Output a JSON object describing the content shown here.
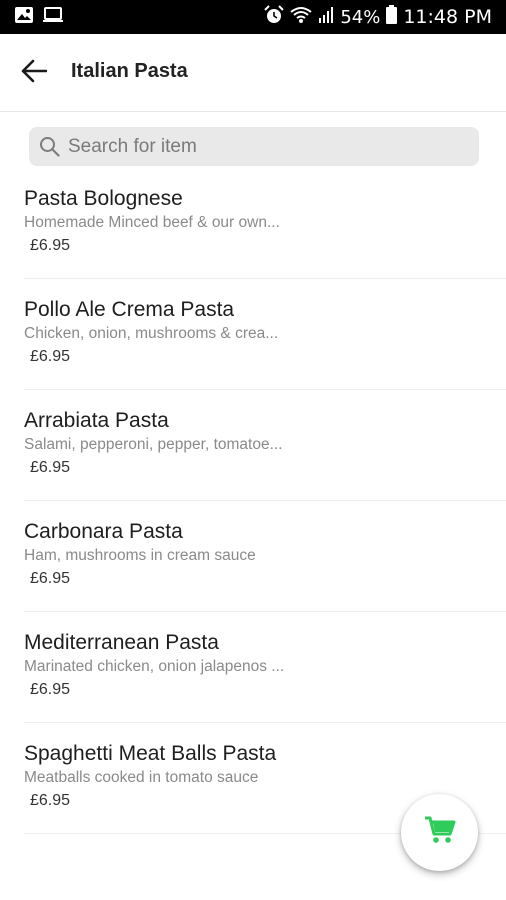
{
  "status_bar": {
    "battery_percent": "54%",
    "time": "11:48 PM",
    "icons": [
      "image-icon",
      "laptop-icon",
      "alarm-icon",
      "wifi-icon",
      "signal-icon",
      "battery-icon"
    ]
  },
  "header": {
    "title": "Italian Pasta",
    "back_icon": "arrow-left-icon"
  },
  "search": {
    "placeholder": "Search for item",
    "value": ""
  },
  "items": [
    {
      "name": "Pasta Bolognese",
      "description": "Homemade  Minced beef & our own...",
      "price": "£6.95"
    },
    {
      "name": "Pollo Ale Crema Pasta",
      "description": "Chicken, onion, mushrooms & crea...",
      "price": "£6.95"
    },
    {
      "name": "Arrabiata Pasta",
      "description": "Salami, pepperoni, pepper, tomatoe...",
      "price": "£6.95"
    },
    {
      "name": "Carbonara Pasta",
      "description": "Ham, mushrooms in cream sauce",
      "price": "£6.95"
    },
    {
      "name": "Mediterranean Pasta",
      "description": "Marinated chicken, onion jalapenos ...",
      "price": "£6.95"
    },
    {
      "name": "Spaghetti Meat Balls Pasta",
      "description": "Meatballs cooked in tomato sauce",
      "price": "£6.95"
    }
  ],
  "cart_button": {
    "icon": "cart-icon",
    "color": "#2ecc5a"
  }
}
